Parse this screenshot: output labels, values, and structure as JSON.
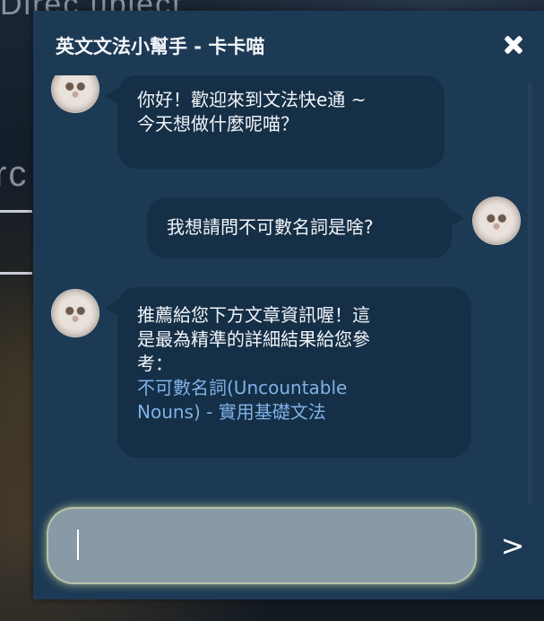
{
  "background": {
    "text_top": "Direc ubiect",
    "text_mid": "rc"
  },
  "chat": {
    "title": "英文文法小幫手 - 卡卡喵",
    "close_icon": "close-icon",
    "messages": [
      {
        "from": "bot",
        "lines": [
          "你好！歡迎來到文法快e通 ~",
          "今天想做什麼呢喵？"
        ]
      },
      {
        "from": "user",
        "lines": [
          "我想請問不可數名詞是啥?"
        ]
      },
      {
        "from": "bot",
        "lines": [
          "推薦給您下方文章資訊喔！這",
          "是最為精準的詳細結果給您參",
          "考："
        ],
        "link_lines": [
          "不可數名詞(Uncountable",
          "Nouns) - 實用基礎文法"
        ]
      }
    ],
    "input": {
      "value": "",
      "placeholder": ""
    },
    "send_label": ">"
  },
  "colors": {
    "panel": "#1d3a55",
    "bubble": "#152f47",
    "link": "#7fb2e6",
    "input": "#879aa6"
  }
}
